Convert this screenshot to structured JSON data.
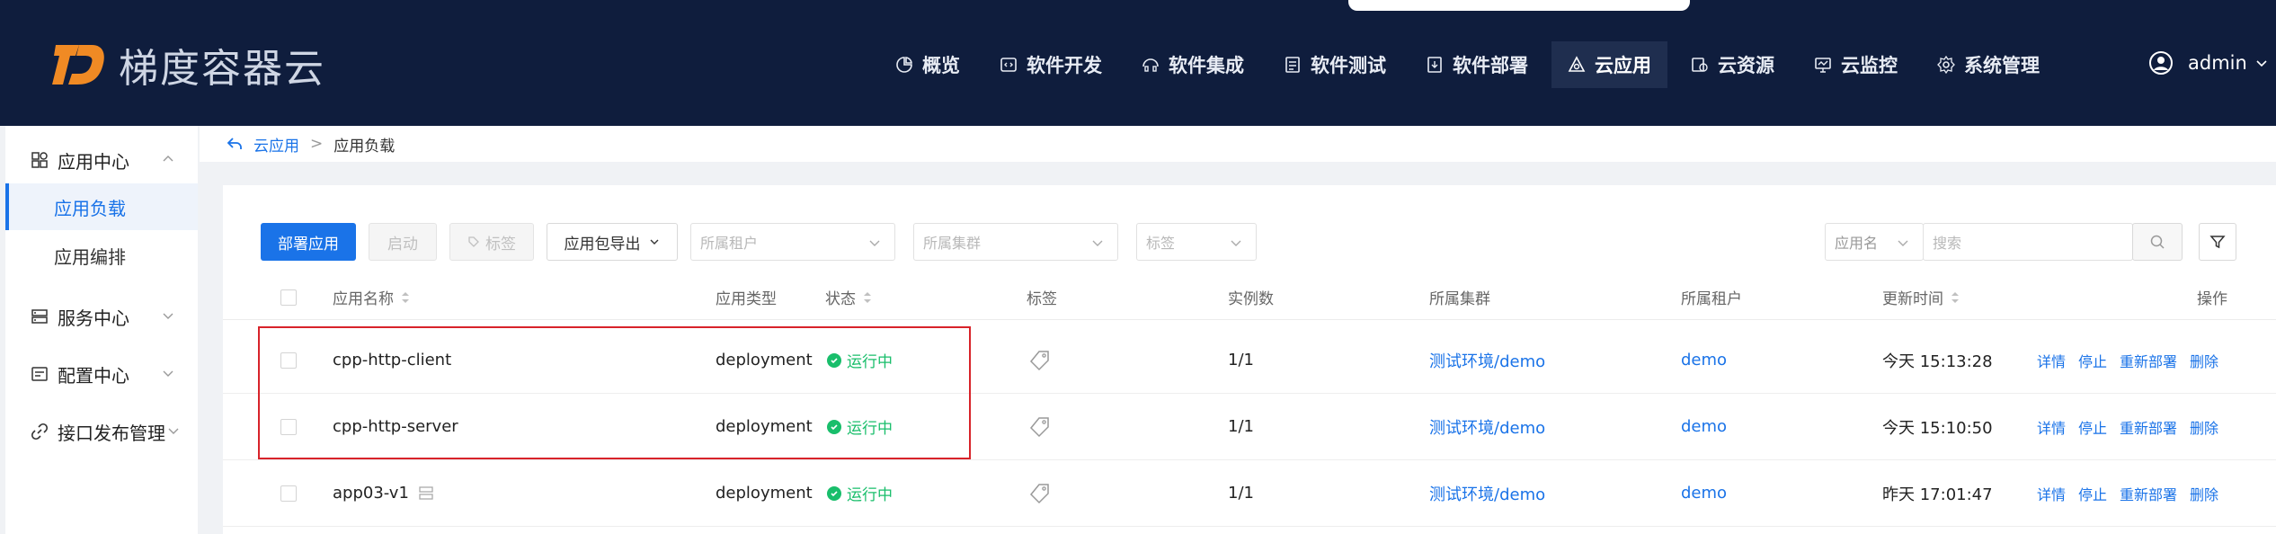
{
  "header": {
    "logo_text": "梯度容器云",
    "nav": [
      {
        "label": "概览",
        "icon": "pie-chart-icon"
      },
      {
        "label": "软件开发",
        "icon": "code-icon"
      },
      {
        "label": "软件集成",
        "icon": "integration-icon"
      },
      {
        "label": "软件测试",
        "icon": "test-icon"
      },
      {
        "label": "软件部署",
        "icon": "deploy-icon"
      },
      {
        "label": "云应用",
        "icon": "cloud-app-icon",
        "active": true
      },
      {
        "label": "云资源",
        "icon": "cloud-resource-icon"
      },
      {
        "label": "云监控",
        "icon": "monitor-icon"
      },
      {
        "label": "系统管理",
        "icon": "gear-icon"
      }
    ],
    "user": "admin"
  },
  "sidebar": {
    "app_center": "应用中心",
    "app_workload": "应用负载",
    "app_orchestration": "应用编排",
    "service_center": "服务中心",
    "config_center": "配置中心",
    "api_publish": "接口发布管理"
  },
  "breadcrumb": {
    "parent": "云应用",
    "current": "应用负载"
  },
  "toolbar": {
    "deploy_label": "部署应用",
    "start_label": "启动",
    "tag_label": "标签",
    "export_label": "应用包导出",
    "tenant_placeholder": "所属租户",
    "cluster_placeholder": "所属集群",
    "tag_placeholder": "标签",
    "search_field": "应用名",
    "search_placeholder": "搜索"
  },
  "table": {
    "columns": {
      "name": "应用名称",
      "type": "应用类型",
      "status": "状态",
      "tag": "标签",
      "instances": "实例数",
      "cluster": "所属集群",
      "tenant": "所属租户",
      "updated": "更新时间",
      "actions": "操作"
    },
    "rows": [
      {
        "name": "cpp-http-client",
        "type": "deployment",
        "status": "运行中",
        "instances": "1/1",
        "cluster": "测试环境/demo",
        "tenant": "demo",
        "updated": "今天 15:13:28"
      },
      {
        "name": "cpp-http-server",
        "type": "deployment",
        "status": "运行中",
        "instances": "1/1",
        "cluster": "测试环境/demo",
        "tenant": "demo",
        "updated": "今天 15:10:50"
      },
      {
        "name": "app03-v1",
        "type": "deployment",
        "status": "运行中",
        "instances": "1/1",
        "cluster": "测试环境/demo",
        "tenant": "demo",
        "updated": "昨天 17:01:47"
      }
    ],
    "actions": {
      "detail": "详情",
      "stop": "停止",
      "redeploy": "重新部署",
      "delete": "删除"
    }
  },
  "colors": {
    "header_bg": "#0f1d3d",
    "accent": "#1a73e8",
    "logo_orange": "#f08a24",
    "status_green": "#19be6b",
    "highlight_red": "#d8232a"
  }
}
